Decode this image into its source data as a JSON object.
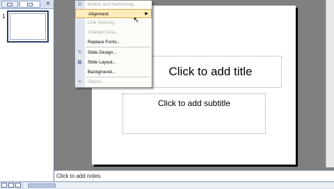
{
  "left_pane": {
    "close_glyph": "×",
    "slide_number": "1",
    "tab_outline": "outline-tab",
    "tab_slides": "slides-tab"
  },
  "menu": {
    "items": [
      {
        "label": "Bullets and Numbering...",
        "enabled": true,
        "icon": "bullets-icon"
      },
      {
        "label": "Alignment",
        "enabled": true,
        "highlighted": true,
        "submenu": true
      },
      {
        "label": "Line Spacing...",
        "enabled": false
      },
      {
        "label": "Change Case...",
        "enabled": false
      },
      {
        "label": "Replace Fonts...",
        "enabled": true
      },
      {
        "label": "Slide Design...",
        "enabled": true,
        "icon": "slide-design-icon"
      },
      {
        "label": "Slide Layout...",
        "enabled": true,
        "icon": "slide-layout-icon"
      },
      {
        "label": "Background...",
        "enabled": true
      },
      {
        "label": "Object...",
        "enabled": false,
        "icon": "object-icon"
      }
    ],
    "submenu_arrow": "▶"
  },
  "slide": {
    "title_placeholder": "Click to add title",
    "subtitle_placeholder": "Click to add subtitle"
  },
  "notes": {
    "placeholder": "Click to add notes"
  },
  "colors": {
    "workspace": "#808080",
    "menu_highlight": "#ffeebd",
    "pane_blue": "#d6dff0"
  }
}
